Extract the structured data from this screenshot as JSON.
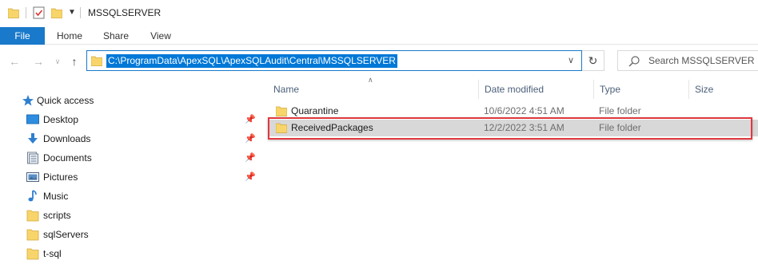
{
  "window": {
    "title": "MSSQLSERVER"
  },
  "ribbon": {
    "tabs": [
      {
        "label": "File"
      },
      {
        "label": "Home"
      },
      {
        "label": "Share"
      },
      {
        "label": "View"
      }
    ]
  },
  "address": {
    "path": "C:\\ProgramData\\ApexSQL\\ApexSQLAudit\\Central\\MSSQLSERVER"
  },
  "search": {
    "placeholder": "Search MSSQLSERVER"
  },
  "navpane": {
    "quick_access": {
      "label": "Quick access",
      "icon": "star-icon"
    },
    "items": [
      {
        "label": "Desktop",
        "icon": "desktop-icon",
        "pinned": true
      },
      {
        "label": "Downloads",
        "icon": "download-icon",
        "pinned": true
      },
      {
        "label": "Documents",
        "icon": "documents-icon",
        "pinned": true
      },
      {
        "label": "Pictures",
        "icon": "pictures-icon",
        "pinned": true
      },
      {
        "label": "Music",
        "icon": "music-icon",
        "pinned": false
      },
      {
        "label": "scripts",
        "icon": "folder-icon",
        "pinned": false
      },
      {
        "label": "sqlServers",
        "icon": "folder-icon",
        "pinned": false
      },
      {
        "label": "t-sql",
        "icon": "folder-icon",
        "pinned": false
      }
    ]
  },
  "filelist": {
    "columns": [
      "Name",
      "Date modified",
      "Type",
      "Size"
    ],
    "rows": [
      {
        "name": "Quarantine",
        "date": "10/6/2022 4:51 AM",
        "type": "File folder",
        "size": ""
      },
      {
        "name": "ReceivedPackages",
        "date": "12/2/2022 3:51 AM",
        "type": "File folder",
        "size": "",
        "selected": true,
        "highlighted": true
      }
    ]
  },
  "colors": {
    "accent": "#1979ca",
    "selection": "#0078d7",
    "highlight_border": "#e0383e",
    "folder": "#f7d56b",
    "header_text": "#4c607a"
  }
}
